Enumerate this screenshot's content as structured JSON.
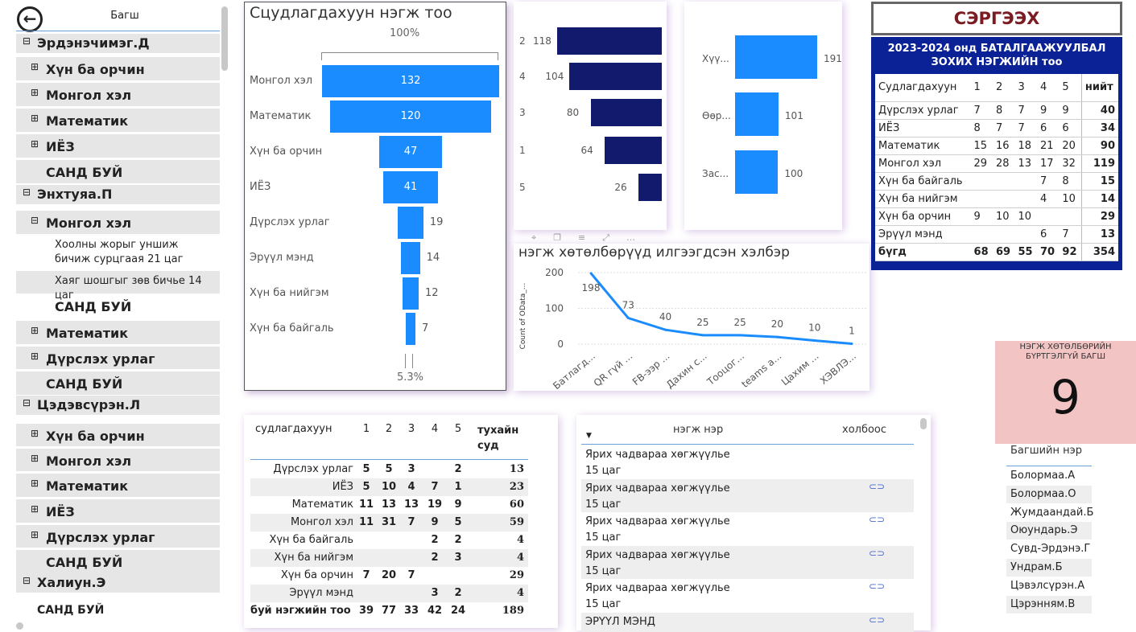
{
  "tree": {
    "header": "Багш",
    "back_icon": "back-arrow-icon",
    "rows": [
      {
        "label": "Эрдэнэчимэг.Д",
        "kind": "teacher",
        "expander": "⊟"
      },
      {
        "label": "Хүн ба орчин",
        "kind": "subject",
        "expander": "⊞"
      },
      {
        "label": "Монгол хэл",
        "kind": "subject",
        "expander": "⊞"
      },
      {
        "label": "Математик",
        "kind": "subject",
        "expander": "⊞"
      },
      {
        "label": "ИЁЗ",
        "kind": "subject",
        "expander": "⊞"
      },
      {
        "label": "САНД БУЙ",
        "kind": "total",
        "expander": ""
      },
      {
        "label": "Энхтуяа.П",
        "kind": "teacher",
        "expander": "⊟"
      },
      {
        "label": "Монгол хэл",
        "kind": "subject",
        "expander": "⊟"
      },
      {
        "label": "Хоолны жорыг уншиж бичиж сурцгаая 21 цаг",
        "kind": "leaf",
        "expander": ""
      },
      {
        "label": "Хаяг шошгыг зөв бичье 14 цаг",
        "kind": "leaf",
        "expander": ""
      },
      {
        "label": "САНД БУЙ",
        "kind": "total2",
        "expander": ""
      },
      {
        "label": "Математик",
        "kind": "subject",
        "expander": "⊞"
      },
      {
        "label": "Дүрслэх урлаг",
        "kind": "subject",
        "expander": "⊞"
      },
      {
        "label": "САНД БУЙ",
        "kind": "total",
        "expander": ""
      },
      {
        "label": "Цэдэвсүрэн.Л",
        "kind": "teacher",
        "expander": "⊟"
      },
      {
        "label": "Хүн ба орчин",
        "kind": "subject",
        "expander": "⊞"
      },
      {
        "label": "Монгол хэл",
        "kind": "subject",
        "expander": "⊞"
      },
      {
        "label": "Математик",
        "kind": "subject",
        "expander": "⊞"
      },
      {
        "label": "ИЁЗ",
        "kind": "subject",
        "expander": "⊞"
      },
      {
        "label": "Дүрслэх урлаг",
        "kind": "subject",
        "expander": "⊞"
      },
      {
        "label": "САНД БУЙ",
        "kind": "total",
        "expander": ""
      },
      {
        "label": "Халиун.Э",
        "kind": "teacher",
        "expander": "⊟"
      },
      {
        "label": "САНД БУЙ",
        "kind": "total3",
        "expander": ""
      }
    ]
  },
  "funnel": {
    "title": "Сцудлагдахуун нэгж тоо",
    "top_pct": "100%",
    "bottom_pct": "5.3%"
  },
  "chart_data": [
    {
      "type": "bar",
      "title": "Сцудлагдахуун нэгж тоо",
      "categories": [
        "Монгол хэл",
        "Математик",
        "Хүн ба орчин",
        "ИЁЗ",
        "Дүрслэх урлаг",
        "Эрүүл мэнд",
        "Хүн ба нийгэм",
        "Хүн ба байгаль"
      ],
      "values": [
        132,
        120,
        47,
        41,
        19,
        14,
        12,
        7
      ]
    },
    {
      "type": "bar",
      "categories": [
        "2",
        "4",
        "3",
        "1",
        "5"
      ],
      "values": [
        118,
        104,
        80,
        64,
        26
      ]
    },
    {
      "type": "bar",
      "categories": [
        "Хүү...",
        "Өөр...",
        "Зас..."
      ],
      "values": [
        191,
        101,
        100
      ]
    },
    {
      "type": "line",
      "title": "нэгж хөтөлбөрүүд илгээгдсэн хэлбэр",
      "ylabel": "Count of OData_...",
      "categories": [
        "Батлагд...",
        "QR гүй ...",
        "FB-ээр ...",
        "Дахин с...",
        "Тооцог...",
        "teams a...",
        "Цахим ...",
        "ХЭВЛЭ..."
      ],
      "values": [
        198,
        73,
        40,
        25,
        25,
        20,
        10,
        1
      ],
      "yticks": [
        "0",
        "100",
        "200"
      ],
      "ylim": [
        0,
        200
      ]
    }
  ],
  "reset": {
    "label": "СЭРГЭЭХ"
  },
  "summary": {
    "title": "2023-2024 онд БАТАЛГААЖУУЛБАЛ ЗОХИХ НЭГЖИЙН тоо",
    "header": [
      "Судлагдахуун",
      "1",
      "2",
      "3",
      "4",
      "5",
      "нийт"
    ],
    "rows": [
      [
        "Дүрслэх урлаг",
        "7",
        "8",
        "7",
        "9",
        "9",
        "40"
      ],
      [
        "ИЁЗ",
        "8",
        "7",
        "7",
        "6",
        "6",
        "34"
      ],
      [
        "Математик",
        "15",
        "16",
        "18",
        "21",
        "20",
        "90"
      ],
      [
        "Монгол хэл",
        "29",
        "28",
        "13",
        "17",
        "32",
        "119"
      ],
      [
        "Хүн ба байгаль",
        "",
        "",
        "",
        "7",
        "8",
        "15"
      ],
      [
        "Хүн ба нийгэм",
        "",
        "",
        "",
        "4",
        "10",
        "14"
      ],
      [
        "Хүн ба орчин",
        "9",
        "10",
        "10",
        "",
        "",
        "29"
      ],
      [
        "Эрүүл мэнд",
        "",
        "",
        "",
        "6",
        "7",
        "13"
      ]
    ],
    "total": [
      "бүгд",
      "68",
      "69",
      "55",
      "70",
      "92",
      "354"
    ]
  },
  "kpi": {
    "title": "НЭГЖ ХӨТӨЛБӨРИЙН БҮРТГЭЛГҮЙ БАГШ",
    "value": "9"
  },
  "bottom_table": {
    "header": [
      "судлагдахуун",
      "1",
      "2",
      "3",
      "4",
      "5",
      "тухайн суд"
    ],
    "rows": [
      [
        "Дүрслэх урлаг",
        "5",
        "5",
        "3",
        "",
        "2",
        "13"
      ],
      [
        "ИЁЗ",
        "5",
        "10",
        "4",
        "7",
        "1",
        "23"
      ],
      [
        "Математик",
        "11",
        "13",
        "13",
        "19",
        "9",
        "60"
      ],
      [
        "Монгол хэл",
        "11",
        "31",
        "7",
        "9",
        "5",
        "59"
      ],
      [
        "Хүн ба байгаль",
        "",
        "",
        "",
        "2",
        "2",
        "4"
      ],
      [
        "Хүн ба нийгэм",
        "",
        "",
        "",
        "2",
        "3",
        "4"
      ],
      [
        "Хүн ба орчин",
        "7",
        "20",
        "7",
        "",
        "",
        "29"
      ],
      [
        "Эрүүл мэнд",
        "",
        "",
        "",
        "3",
        "2",
        "4"
      ]
    ],
    "total": [
      "буй нэгжийн тоо",
      "39",
      "77",
      "33",
      "42",
      "24",
      "189"
    ]
  },
  "units_table": {
    "header_name": "нэгж нэр",
    "header_link": "холбоос",
    "rows": [
      {
        "name": "Ярих чадвараа хөгжүүлье 15 цаг",
        "link": false
      },
      {
        "name": "Ярих чадвараа хөгжүүлье 15 цаг",
        "link": true
      },
      {
        "name": "Ярих чадвараа хөгжүүлье 15 цаг",
        "link": true
      },
      {
        "name": "Ярих чадвараа хөгжүүлье 15 цаг",
        "link": true
      },
      {
        "name": "Ярих чадвараа хөгжүүлье 15 цаг",
        "link": true
      },
      {
        "name": "ЭРҮҮЛ МЭНД",
        "link": true
      }
    ]
  },
  "teacher_list": {
    "header": "Багшийн нэр",
    "items": [
      "Болормаа.А",
      "Болормаа.О",
      "Жумдаандай.Б",
      "Оюундарь.Э",
      "Сувд-Эрдэнэ.Г",
      "Ундрам.Б",
      "Цэвэлсүрэн.А",
      "Цэрэнням.В"
    ]
  },
  "colors": {
    "bar_blue": "#1a8cff",
    "navy": "#121a6e",
    "header_blue": "#0b2196",
    "kpi_bg": "#f2c4c4",
    "reset_text": "#7a1c22"
  }
}
